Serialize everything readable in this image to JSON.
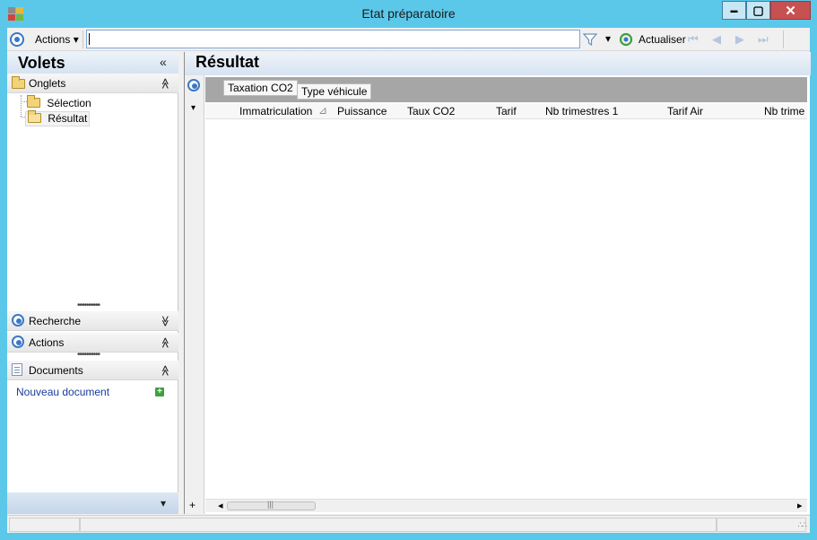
{
  "window": {
    "title": "Etat préparatoire",
    "minimize_glyph": "▬",
    "maximize_glyph": "▢",
    "close_glyph": "✕"
  },
  "toolbar": {
    "actions_label": "Actions",
    "actions_arrow": "▾",
    "search_value": "",
    "filter_arrow": "▾",
    "refresh_label": "Actualiser",
    "nav_first": "⏮",
    "nav_prev": "◀",
    "nav_next": "▶",
    "nav_last": "⏭"
  },
  "left_panel": {
    "title": "Volets",
    "collapse_glyph": "«",
    "onglets": {
      "label": "Onglets",
      "items": [
        {
          "label": "Sélection"
        },
        {
          "label": "Résultat"
        }
      ]
    },
    "recherche_label": "Recherche",
    "actions_label": "Actions",
    "documents_label": "Documents",
    "new_document_label": "Nouveau document",
    "expand_glyph": "≫",
    "collapse_up_glyph": "≪",
    "bottom_arrow": "▾"
  },
  "main": {
    "title": "Résultat",
    "group_chips": [
      "Taxation CO2",
      "Type véhicule"
    ],
    "row_menu_arrow": "▾",
    "columns": [
      "Immatriculation",
      "Puissance",
      "Taux CO2",
      "Tarif",
      "Nb trimestres 1",
      "Tarif Air",
      "Nb trime"
    ],
    "add_row_glyph": "+",
    "scroll_left": "◂",
    "scroll_right": "▸",
    "thumb_grip": "|||"
  },
  "colors": {
    "titlebar": "#5bc8ea",
    "accent": "#3a78c4",
    "link": "#1a3c9a"
  }
}
